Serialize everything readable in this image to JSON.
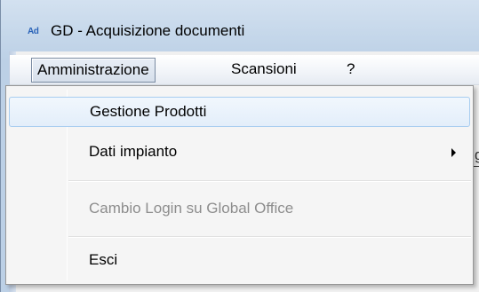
{
  "window": {
    "icon_text": "Ad",
    "title": "GD - Acquisizione documenti"
  },
  "menubar": {
    "items": [
      {
        "label": "Amministrazione",
        "active": true
      },
      {
        "label": "Scansioni",
        "active": false
      },
      {
        "label": "?",
        "active": false
      }
    ]
  },
  "dropdown": {
    "items": [
      {
        "label": "Gestione Prodotti",
        "state": "highlighted"
      },
      {
        "label": "Dati impianto",
        "state": "normal",
        "has_submenu": true
      },
      {
        "label": "Cambio Login su Global Office",
        "state": "disabled"
      },
      {
        "label": "Esci",
        "state": "normal"
      }
    ]
  },
  "behind": {
    "glyph": "g"
  }
}
